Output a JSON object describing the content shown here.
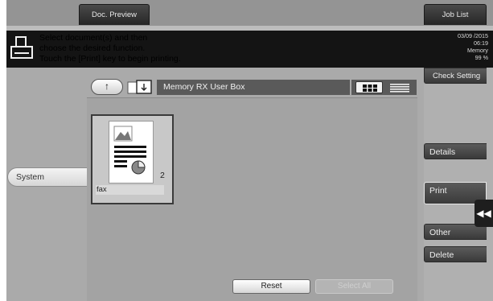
{
  "header": {
    "doc_preview_label": "Doc. Preview",
    "job_list_label": "Job List"
  },
  "message": {
    "lines": [
      "Select document(s) and then",
      "choose the desired function.",
      "Touch the [Print] key to begin printing."
    ],
    "icon": "printer-icon"
  },
  "status": {
    "date": "03/09 /2015",
    "time": "06:19",
    "memory_label": "Memory",
    "memory_value": "99 %"
  },
  "right_panel": {
    "check_setting_label": "Check Setting",
    "details_label": "Details",
    "print_label": "Print",
    "other_label": "Other",
    "delete_label": "Delete",
    "collapse_icon": "double-chevron-left-icon"
  },
  "left_panel": {
    "system_label": "System"
  },
  "navigation": {
    "up_icon": "up-arrow-icon",
    "box_icon": "user-box-icon",
    "breadcrumb": "Memory RX User Box",
    "view_options": [
      "thumbnail-view-icon",
      "list-view-icon"
    ]
  },
  "documents": [
    {
      "name": "fax",
      "count": "2",
      "icon": "document-thumbnail-icon"
    }
  ],
  "footer": {
    "reset_label": "Reset",
    "select_all_label": "Select All"
  },
  "colors": {
    "panel_bg": "#aaaaaa",
    "message_bar": "#141414",
    "dark_button": "#3a3a3a",
    "breadcrumb_bg": "#5a5a5a"
  }
}
